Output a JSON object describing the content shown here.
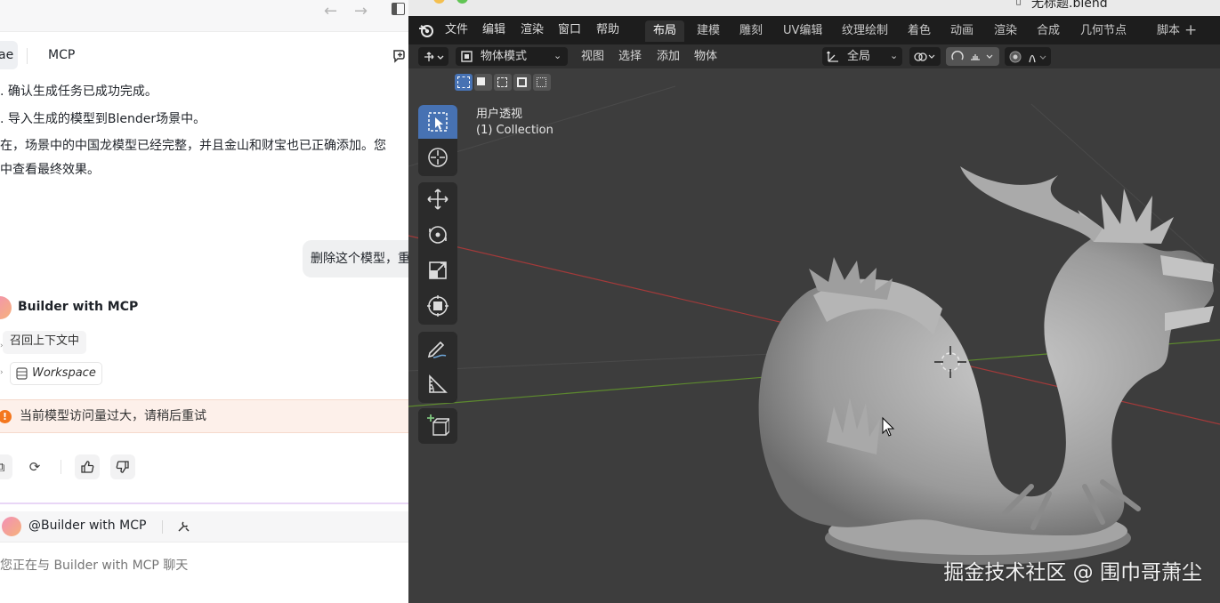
{
  "chat": {
    "nav": {
      "back": "←",
      "forward": "→"
    },
    "tabs": [
      {
        "label": "ae"
      },
      {
        "label": "MCP"
      }
    ],
    "message_lines": [
      ". 确认生成任务已成功完成。",
      ". 导入生成的模型到Blender场景中。",
      "在，场景中的中国龙模型已经完整，并且金山和财宝也已正确添加。您",
      "中查看最终效果。"
    ],
    "user_bubble": "删除这个模型，重",
    "assistant_name": "Builder with MCP",
    "context_chip": "召回上下文中",
    "workspace_chip": "Workspace",
    "error_text": "当前模型访问量过大，请稍后重试",
    "error_icon": "!",
    "composer": {
      "mention": "@Builder with MCP",
      "placeholder": "您正在与 Builder with MCP 聊天"
    }
  },
  "blender": {
    "window_title": "无标题.blend",
    "menu": [
      "文件",
      "编辑",
      "渲染",
      "窗口",
      "帮助"
    ],
    "workspace_tabs": [
      "布局",
      "建模",
      "雕刻",
      "UV编辑",
      "纹理绘制",
      "着色",
      "动画",
      "渲染",
      "合成",
      "几何节点",
      "脚本"
    ],
    "active_tab": "布局",
    "add_tab": "+",
    "header": {
      "mode": "物体模式",
      "menus": [
        "视图",
        "选择",
        "添加",
        "物体"
      ],
      "transform_orientation": "全局"
    },
    "viewport": {
      "view_name": "用户透视",
      "collection": "(1) Collection"
    },
    "watermark": "掘金技术社区 @ 围巾哥萧尘"
  },
  "colors": {
    "accent_blue": "#4772b3",
    "warning_orange": "#f4771e",
    "viewport_bg": "#3d3d3d",
    "x_axis": "#a33a3a",
    "y_axis": "#5d8a2e"
  }
}
